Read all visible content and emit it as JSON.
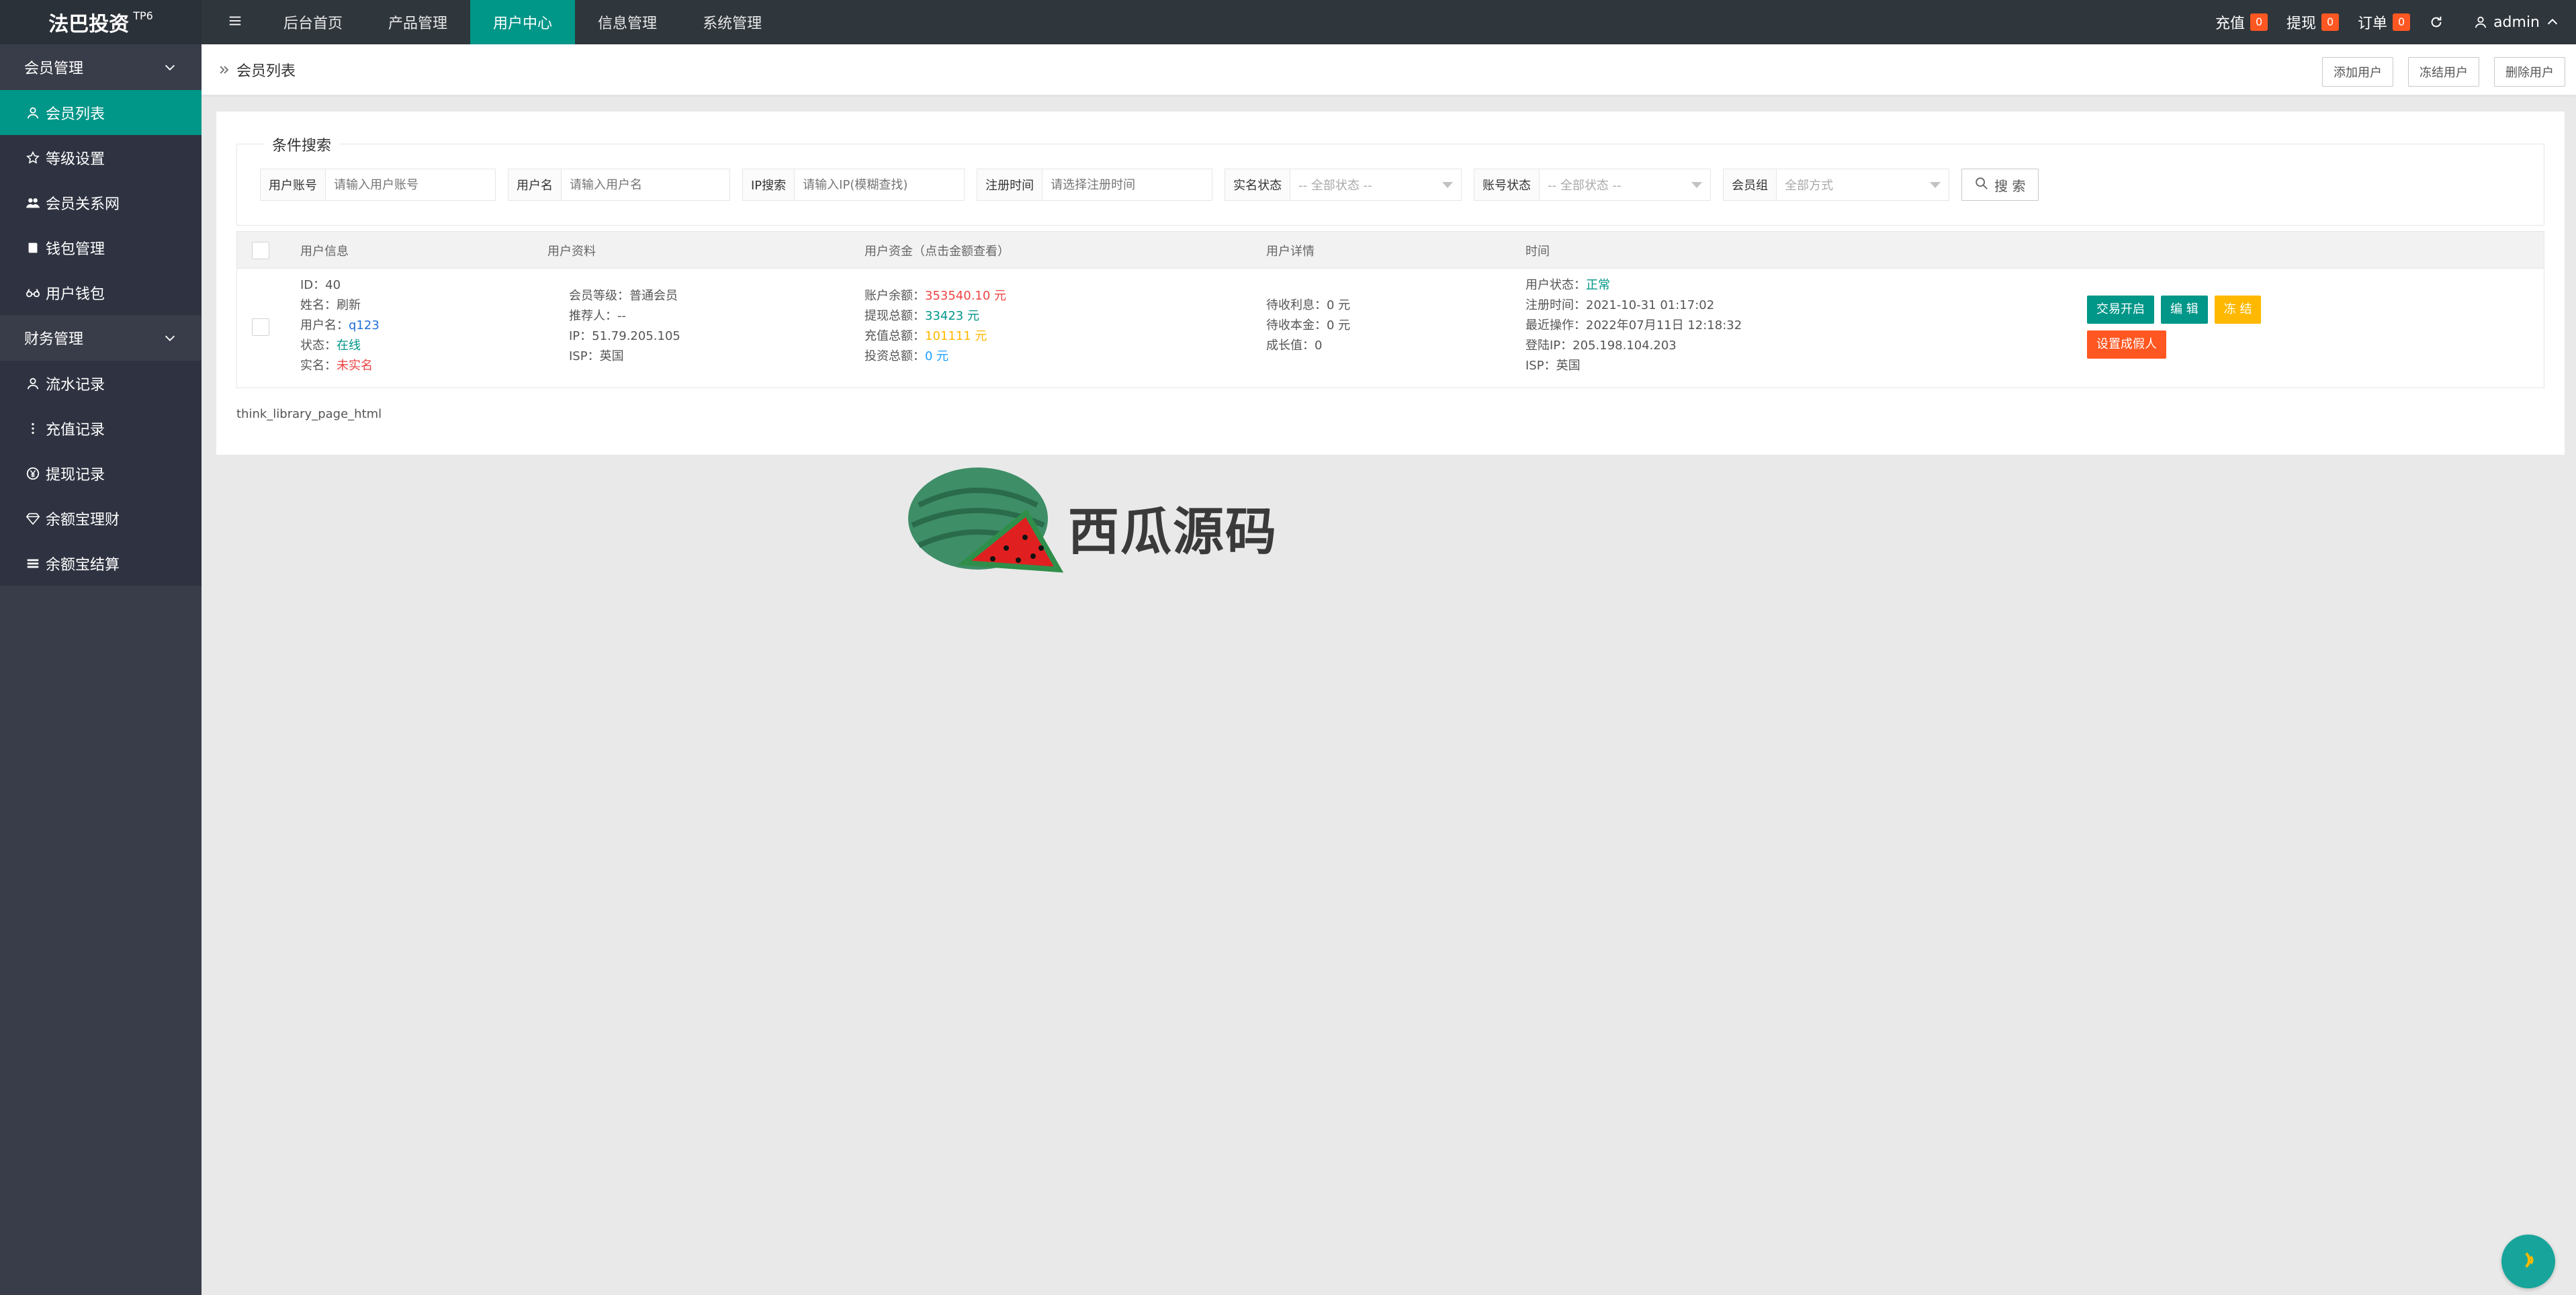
{
  "brand": {
    "title": "法巴投资",
    "sup": "TP6"
  },
  "topnav": [
    {
      "label": "后台首页",
      "active": false
    },
    {
      "label": "产品管理",
      "active": false
    },
    {
      "label": "用户中心",
      "active": true
    },
    {
      "label": "信息管理",
      "active": false
    },
    {
      "label": "系统管理",
      "active": false
    }
  ],
  "topright": {
    "recharge_label": "充值",
    "recharge_count": "0",
    "withdraw_label": "提现",
    "withdraw_count": "0",
    "order_label": "订单",
    "order_count": "0",
    "user": "admin"
  },
  "sidebar": {
    "group1": "会员管理",
    "group1_items": [
      "会员列表",
      "等级设置",
      "会员关系网",
      "钱包管理",
      "用户钱包"
    ],
    "group2": "财务管理",
    "group2_items": [
      "流水记录",
      "充值记录",
      "提现记录",
      "余额宝理财",
      "余额宝结算"
    ]
  },
  "breadcrumb": "会员列表",
  "actions": {
    "add": "添加用户",
    "freeze": "冻结用户",
    "delete": "删除用户"
  },
  "search": {
    "legend": "条件搜索",
    "account_label": "用户账号",
    "account_placeholder": "请输入用户账号",
    "name_label": "用户名",
    "name_placeholder": "请输入用户名",
    "ip_label": "IP搜索",
    "ip_placeholder": "请输入IP(模糊查找)",
    "regtime_label": "注册时间",
    "regtime_placeholder": "请选择注册时间",
    "realname_label": "实名状态",
    "realname_value": "-- 全部状态 --",
    "account_status_label": "账号状态",
    "account_status_value": "-- 全部状态 --",
    "group_label": "会员组",
    "group_value": "全部方式",
    "search_button": "搜 索"
  },
  "table": {
    "headers": [
      "用户信息",
      "用户资料",
      "用户资金（点击金额查看）",
      "用户详情",
      "时间"
    ],
    "row": {
      "id": "ID：40",
      "name": "姓名：刷新",
      "username_label": "用户名：",
      "username": "q123",
      "status_label": "状态：",
      "status": "在线",
      "realname_label": "实名：",
      "realname": "未实名",
      "level": "会员等级：普通会员",
      "referrer": "推荐人：--",
      "ip": "IP：51.79.205.105",
      "isp": "ISP：英国",
      "balance_label": "账户余额：",
      "balance": "353540.10 元",
      "withdraw_label": "提现总额：",
      "withdraw": "33423 元",
      "recharge_label": "充值总额：",
      "recharge": "101111 元",
      "invest_label": "投资总额：",
      "invest": "0 元",
      "interest": "待收利息：0 元",
      "principal": "待收本金：0 元",
      "growth": "成长值：0",
      "user_status_label": "用户状态：",
      "user_status": "正常",
      "reg_time": "注册时间：2021-10-31 01:17:02",
      "last_op": "最近操作：2022年07月11日 12:18:32",
      "login_ip": "登陆IP：205.198.104.203",
      "isp2": "ISP：英国",
      "btn_trade": "交易开启",
      "btn_edit": "编 辑",
      "btn_freeze": "冻 结",
      "btn_fake": "设置成假人"
    }
  },
  "pager_text": "think_library_page_html",
  "watermark": "西瓜源码",
  "colors": {
    "accent": "#009688",
    "topbar": "#2f363c",
    "sidebar": "#393d49",
    "danger": "#ff5722",
    "warn": "#ffb800",
    "info": "#1e9fff"
  }
}
